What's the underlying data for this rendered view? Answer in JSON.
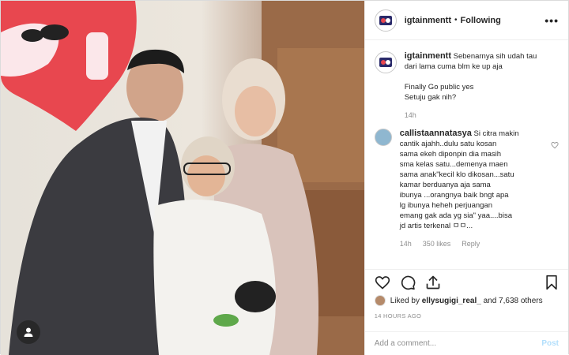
{
  "post": {
    "username": "igtainmentt",
    "follow_status": "Following",
    "more_label": "•••",
    "caption": {
      "username": "igtainmentt",
      "lines": [
        "Sebenarnya sih udah tau",
        "dari lama cuma blm ke up aja",
        "",
        "Finally Go public yes",
        "Setuju gak nih?"
      ],
      "time": "14h"
    },
    "comment": {
      "username": "callistaannatasya",
      "lines": [
        "Si citra makin",
        "cantik ajahh..dulu satu kosan",
        "sama ekeh diponpin dia masih",
        "sma kelas satu...demenya maen",
        "sama anak\"kecil klo dikosan...satu",
        "kamar berduanya aja sama",
        "ibunya ...orangnya baik bngt apa",
        "lg ibunya heheh perjuangan",
        "emang gak ada yg sia\" yaa....bisa",
        "jd artis terkenal ㅁㅁ..."
      ],
      "time": "14h",
      "likes": "350 likes",
      "reply": "Reply"
    },
    "likes_text_prefix": "Liked by ",
    "likes_user": "ellysugigi_real_",
    "likes_text_suffix": " and 7,638 others",
    "timestamp": "14 HOURS AGO",
    "add_comment_placeholder": "Add a comment...",
    "post_button": "Post",
    "colors": {
      "accent_blue": "#b2dffc",
      "muted": "#8e8e8e"
    }
  }
}
